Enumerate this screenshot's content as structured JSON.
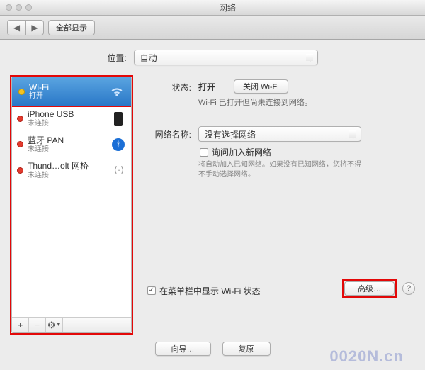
{
  "window": {
    "title": "网络"
  },
  "toolbar": {
    "show_all": "全部显示"
  },
  "location": {
    "label": "位置:",
    "value": "自动"
  },
  "sidebar": {
    "items": [
      {
        "name": "Wi-Fi",
        "status": "打开"
      },
      {
        "name": "iPhone USB",
        "status": "未连接"
      },
      {
        "name": "蓝牙 PAN",
        "status": "未连接"
      },
      {
        "name": "Thund…olt 网桥",
        "status": "未连接"
      }
    ],
    "add": "+",
    "remove": "−",
    "options": "⚙"
  },
  "main": {
    "status_label": "状态:",
    "status_value": "打开",
    "turn_off_btn": "关闭 Wi-Fi",
    "status_desc": "Wi-Fi 已打开但尚未连接到网络。",
    "network_label": "网络名称:",
    "network_value": "没有选择网络",
    "ask_join_label": "询问加入新网络",
    "ask_join_desc": "将自动加入已知网络。如果没有已知网络，您将不得不手动选择网络。",
    "show_menubar_label": "在菜单栏中显示 Wi-Fi 状态",
    "advanced_btn": "高级…",
    "help_btn": "?"
  },
  "footer": {
    "assistant_btn": "向导…",
    "revert_btn": "复原"
  },
  "watermark": "0020N.cn"
}
